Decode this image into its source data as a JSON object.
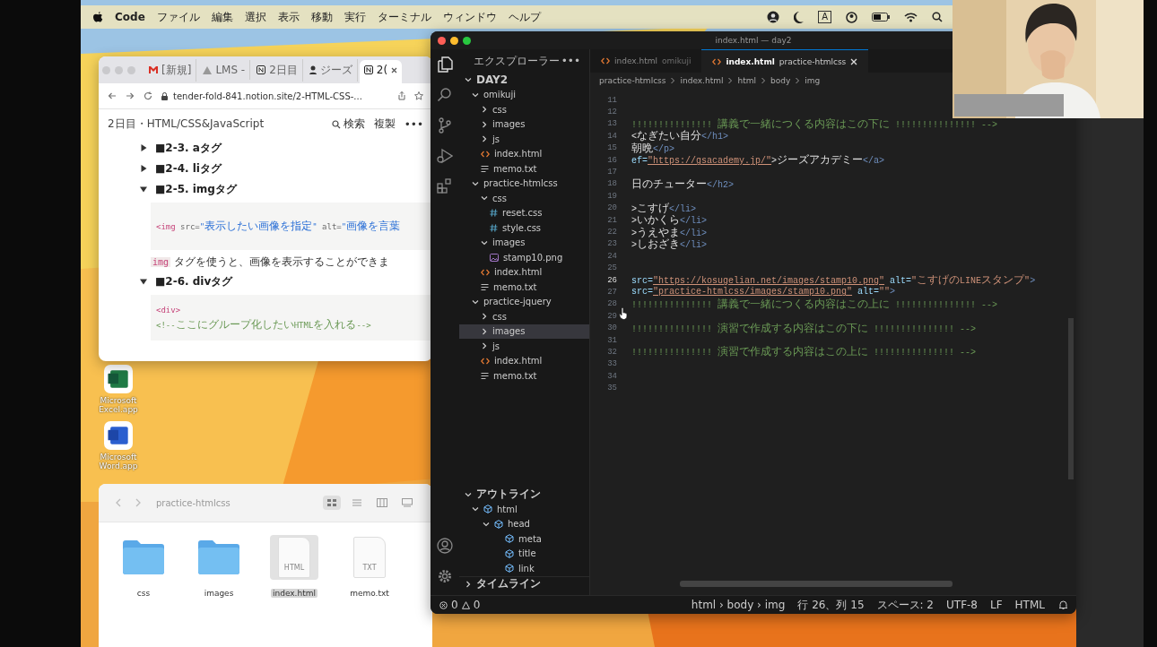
{
  "menu_bar": {
    "app": "Code",
    "items": [
      "ファイル",
      "編集",
      "選択",
      "表示",
      "移動",
      "実行",
      "ターミナル",
      "ウィンドウ",
      "ヘルプ"
    ],
    "input_mode": "A"
  },
  "browser": {
    "tabs": [
      {
        "label": "[新規]",
        "kind": "mail",
        "selected": false
      },
      {
        "label": "LMS -",
        "kind": "drive",
        "selected": false
      },
      {
        "label": "2日目",
        "kind": "notion",
        "selected": false
      },
      {
        "label": "ジーズ",
        "kind": "person",
        "selected": false
      },
      {
        "label": "2(",
        "kind": "notion",
        "selected": true
      }
    ],
    "url": "tender-fold-841.notion.site/2-HTML-CSS-...",
    "page_path": "2日目・HTML/CSS&JavaScript",
    "search": "検索",
    "duplicate": "複製",
    "more": "•••",
    "toggles": [
      {
        "title": "■2-3. aタグ",
        "expanded": false
      },
      {
        "title": "■2-4. liタグ",
        "expanded": false
      },
      {
        "title": "■2-5. imgタグ",
        "expanded": true,
        "blocks": [
          {
            "kind": "code",
            "lines": [
              [
                {
                  "text": "<img",
                  "kind": "tag"
                },
                {
                  "text": " src=",
                  "kind": "attr"
                },
                {
                  "text": "\"表示したい画像を指定\"",
                  "kind": "string"
                },
                {
                  "text": " alt=",
                  "kind": "attr"
                },
                {
                  "text": "\"画像を言葉",
                  "kind": "string"
                }
              ]
            ]
          },
          {
            "kind": "paragraph",
            "code": "img",
            "text": "タグを使うと、画像を表示することができま"
          }
        ]
      },
      {
        "title": "■2-6. divタグ",
        "expanded": true,
        "blocks": [
          {
            "kind": "code",
            "lines": [
              [
                {
                  "text": "<div>",
                  "kind": "tag"
                }
              ],
              [
                {
                  "text": "<!--ここにグループ化したいHTMLを入れる-->",
                  "kind": "comment"
                }
              ]
            ]
          }
        ]
      }
    ]
  },
  "desktop_icons": [
    {
      "label": "Microsoft Excel.app",
      "kind": "excel"
    },
    {
      "label": "Microsoft Word.app",
      "kind": "word"
    }
  ],
  "finder": {
    "path": "practice-htmlcss",
    "views": [
      {
        "kind": "icons",
        "selected": true
      },
      {
        "kind": "list",
        "selected": false
      },
      {
        "kind": "columns",
        "selected": false
      },
      {
        "kind": "gallery",
        "selected": false
      }
    ],
    "items": [
      {
        "name": "css",
        "kind": "folder",
        "selected": false
      },
      {
        "name": "images",
        "kind": "folder",
        "selected": false
      },
      {
        "name": "index.html",
        "kind": "file",
        "badge": "HTML",
        "selected": true
      },
      {
        "name": "memo.txt",
        "kind": "file",
        "badge": "TXT",
        "selected": false
      }
    ]
  },
  "editor": {
    "title": "index.html — day2",
    "explorer": {
      "title": "エクスプローラー",
      "more": "•••",
      "root": "DAY2",
      "tree": [
        {
          "name": "omikuji",
          "kind": "folder",
          "expanded": true,
          "selected": false,
          "children": [
            {
              "name": "css",
              "kind": "folder",
              "expanded": false,
              "selected": false
            },
            {
              "name": "images",
              "kind": "folder",
              "expanded": false,
              "selected": false
            },
            {
              "name": "js",
              "kind": "folder",
              "expanded": false,
              "selected": false
            },
            {
              "name": "index.html",
              "kind": "html",
              "selected": false
            },
            {
              "name": "memo.txt",
              "kind": "txt",
              "selected": false
            }
          ]
        },
        {
          "name": "practice-htmlcss",
          "kind": "folder",
          "expanded": true,
          "selected": false,
          "children": [
            {
              "name": "css",
              "kind": "folder",
              "expanded": true,
              "selected": false,
              "children": [
                {
                  "name": "reset.css",
                  "kind": "css",
                  "selected": false
                },
                {
                  "name": "style.css",
                  "kind": "css",
                  "selected": false
                }
              ]
            },
            {
              "name": "images",
              "kind": "folder",
              "expanded": true,
              "selected": false,
              "children": [
                {
                  "name": "stamp10.png",
                  "kind": "png",
                  "selected": false
                }
              ]
            },
            {
              "name": "index.html",
              "kind": "html",
              "selected": false
            },
            {
              "name": "memo.txt",
              "kind": "txt",
              "selected": false
            }
          ]
        },
        {
          "name": "practice-jquery",
          "kind": "folder",
          "expanded": true,
          "selected": false,
          "children": [
            {
              "name": "css",
              "kind": "folder",
              "expanded": false,
              "selected": false
            },
            {
              "name": "images",
              "kind": "folder",
              "expanded": false,
              "selected": true
            },
            {
              "name": "js",
              "kind": "folder",
              "expanded": false,
              "selected": false
            },
            {
              "name": "index.html",
              "kind": "html",
              "selected": false
            },
            {
              "name": "memo.txt",
              "kind": "txt",
              "selected": false
            }
          ]
        }
      ]
    },
    "outline": {
      "title": "アウトライン",
      "tree": [
        {
          "name": "html",
          "expanded": true,
          "children": [
            {
              "name": "head",
              "expanded": true,
              "children": [
                {
                  "name": "meta"
                },
                {
                  "name": "title"
                },
                {
                  "name": "link"
                }
              ]
            }
          ]
        }
      ]
    },
    "timeline": "タイムライン",
    "problems": {
      "errors": "0",
      "warnings": "0"
    },
    "tabs": [
      {
        "name": "index.html",
        "folder": "omikuji",
        "selected": false
      },
      {
        "name": "index.html",
        "folder": "practice-htmlcss",
        "selected": true
      }
    ],
    "breadcrumb": [
      "practice-htmlcss",
      "index.html",
      "html",
      "body",
      "img"
    ],
    "lines": [
      {
        "number": "11",
        "current": false
      },
      {
        "number": "12",
        "current": false
      },
      {
        "number": "13",
        "current": false,
        "parts": [
          {
            "text": "!!!!!!!!!!!!!!!   講義で一緒につくる内容はこの下に !!!!!!!!!!!!!!! -->",
            "kind": "comment"
          }
        ]
      },
      {
        "number": "14",
        "current": false,
        "parts": [
          {
            "text": "<なぎたい自分",
            "kind": "text"
          },
          {
            "text": "</h1>",
            "kind": "tag"
          }
        ]
      },
      {
        "number": "15",
        "current": false,
        "parts": [
          {
            "text": "朝晩",
            "kind": "text"
          },
          {
            "text": "</p>",
            "kind": "tag"
          }
        ]
      },
      {
        "number": "16",
        "current": false,
        "parts": [
          {
            "text": "ef=",
            "kind": "attr"
          },
          {
            "text": "\"https://gsacademy.jp/\"",
            "kind": "link"
          },
          {
            "text": ">ジーズアカデミー",
            "kind": "text"
          },
          {
            "text": "</a>",
            "kind": "tag"
          }
        ]
      },
      {
        "number": "17",
        "current": false
      },
      {
        "number": "18",
        "current": false,
        "parts": [
          {
            "text": "日のチューター",
            "kind": "text"
          },
          {
            "text": "</h2>",
            "kind": "tag"
          }
        ]
      },
      {
        "number": "19",
        "current": false
      },
      {
        "number": "20",
        "current": false,
        "parts": [
          {
            "text": ">こすげ",
            "kind": "text"
          },
          {
            "text": "</li>",
            "kind": "tag"
          }
        ]
      },
      {
        "number": "21",
        "current": false,
        "parts": [
          {
            "text": ">いかくら",
            "kind": "text"
          },
          {
            "text": "</li>",
            "kind": "tag"
          }
        ]
      },
      {
        "number": "22",
        "current": false,
        "parts": [
          {
            "text": ">うえやま",
            "kind": "text"
          },
          {
            "text": "</li>",
            "kind": "tag"
          }
        ]
      },
      {
        "number": "23",
        "current": false,
        "parts": [
          {
            "text": ">しおざき",
            "kind": "text"
          },
          {
            "text": "</li>",
            "kind": "tag"
          }
        ]
      },
      {
        "number": "24",
        "current": false
      },
      {
        "number": "25",
        "current": false
      },
      {
        "number": "26",
        "current": true,
        "parts": [
          {
            "text": "src=",
            "kind": "attr"
          },
          {
            "text": "\"https://kosugelian.net/images/stamp10.png\"",
            "kind": "link"
          },
          {
            "text": " alt=",
            "kind": "attr"
          },
          {
            "text": "\"こすげのLINEスタンプ\"",
            "kind": "string"
          },
          {
            "text": ">",
            "kind": "tag"
          }
        ]
      },
      {
        "number": "27",
        "current": false,
        "parts": [
          {
            "text": "src=",
            "kind": "attr"
          },
          {
            "text": "\"practice-htmlcss/images/stamp10.png\"",
            "kind": "link"
          },
          {
            "text": " alt=",
            "kind": "attr"
          },
          {
            "text": "\"\"",
            "kind": "string"
          },
          {
            "text": ">",
            "kind": "tag"
          }
        ]
      },
      {
        "number": "28",
        "current": false,
        "parts": [
          {
            "text": "!!!!!!!!!!!!!!! 講義で一緒につくる内容はこの上に !!!!!!!!!!!!!!! -->",
            "kind": "comment"
          }
        ]
      },
      {
        "number": "29",
        "current": false
      },
      {
        "number": "30",
        "current": false,
        "parts": [
          {
            "text": "!!!!!!!!!!!!!!!   演習で作成する内容はこの下に !!!!!!!!!!!!!!! -->",
            "kind": "comment"
          }
        ]
      },
      {
        "number": "31",
        "current": false
      },
      {
        "number": "32",
        "current": false,
        "parts": [
          {
            "text": "!!!!!!!!!!!!!!! 演習で作成する内容はこの上に !!!!!!!!!!!!!!! -->",
            "kind": "comment"
          }
        ]
      },
      {
        "number": "33",
        "current": false
      },
      {
        "number": "34",
        "current": false
      },
      {
        "number": "35",
        "current": false
      }
    ],
    "status": [
      "html › body › img",
      "行 26、列 15",
      "スペース: 2",
      "UTF-8",
      "LF",
      "HTML"
    ]
  }
}
